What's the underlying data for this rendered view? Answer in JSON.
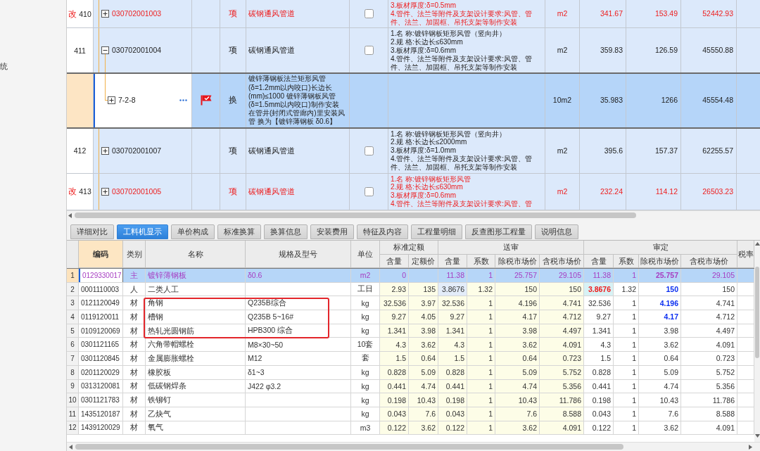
{
  "side_panel": {
    "label": "统"
  },
  "items_table": {
    "rows": [
      {
        "mark": "改",
        "no": "410",
        "modified": true,
        "expanded": false,
        "selected": false,
        "flagged": false,
        "code": "030702001003",
        "type": "项",
        "name": "碳钢通风管道",
        "checked": false,
        "description": [
          "3.板材厚度:δ=0.5mm",
          "4.管件、法兰等附件及支架设计要求:风管、管件、法兰、加固框、吊托支架等制作安装"
        ],
        "unit": "m2",
        "quantity": "341.67",
        "unit_price": "153.49",
        "total": "52442.93"
      },
      {
        "no": "411",
        "modified": false,
        "expanded": true,
        "selected": false,
        "flagged": false,
        "code": "030702001004",
        "type": "项",
        "name": "碳钢通风管道",
        "checked": false,
        "description": [
          "1.名 称:镀锌钢板矩形风管（竖向井）",
          "2.规 格:长边长≤630mm",
          "3.板材厚度:δ=0.6mm",
          "4.管件、法兰等附件及支架设计要求:风管、管件、法兰、加固框、吊托支架等制作安装"
        ],
        "unit": "m2",
        "quantity": "359.83",
        "unit_price": "126.59",
        "total": "45550.88",
        "children": [
          {
            "modified": false,
            "expanded": false,
            "selected": true,
            "flagged": true,
            "code": "7-2-8",
            "type": "换",
            "name": "镀锌薄钢板法兰矩形风管(δ=1.2mm以内咬口)长边长(mm)≤1000 镀锌薄钢板风管(δ=1.5mm以内咬口)制作安装在管井(封闭式管廊内)里安装风管 换为【镀锌薄钢板 δ0.6】",
            "unit": "10m2",
            "quantity": "35.983",
            "unit_price": "1266",
            "total": "45554.48"
          }
        ]
      },
      {
        "no": "412",
        "modified": false,
        "expanded": false,
        "selected": false,
        "flagged": false,
        "code": "030702001007",
        "type": "项",
        "name": "碳钢通风管道",
        "checked": false,
        "description": [
          "1.名 称:镀锌钢板矩形风管（竖向井）",
          "2.规 格:长边长≤2000mm",
          "3.板材厚度:δ=1.0mm",
          "4.管件、法兰等附件及支架设计要求:风管、管件、法兰、加固框、吊托支架等制作安装"
        ],
        "unit": "m2",
        "quantity": "395.6",
        "unit_price": "157.37",
        "total": "62255.57"
      },
      {
        "mark": "改",
        "no": "413",
        "modified": true,
        "expanded": false,
        "selected": false,
        "flagged": false,
        "code": "030702001005",
        "type": "项",
        "name": "碳钢通风管道",
        "checked": false,
        "description": [
          "1.名 称:镀锌钢板矩形风管",
          "2.规 格:长边长≤630mm",
          "3.板材厚度:δ=0.6mm",
          "4.管件、法兰等附件及支架设计要求:风管、管"
        ],
        "unit": "m2",
        "quantity": "232.24",
        "unit_price": "114.12",
        "total": "26503.23"
      }
    ]
  },
  "tabs": [
    {
      "label": "详细对比",
      "selected": false
    },
    {
      "label": "工料机显示",
      "selected": true
    },
    {
      "label": "单价构成",
      "selected": false
    },
    {
      "label": "标准换算",
      "selected": false
    },
    {
      "label": "换算信息",
      "selected": false
    },
    {
      "label": "安装费用",
      "selected": false
    },
    {
      "label": "特征及内容",
      "selected": false
    },
    {
      "label": "工程量明细",
      "selected": false
    },
    {
      "label": "反查图形工程量",
      "selected": false
    },
    {
      "label": "说明信息",
      "selected": false
    }
  ],
  "resources_table": {
    "header": [
      {
        "label": "编码",
        "selected": true
      },
      {
        "label": "类别",
        "selected": false
      },
      {
        "label": "名称",
        "selected": false
      },
      {
        "label": "规格及型号",
        "selected": false
      },
      {
        "label": "单位",
        "selected": false
      },
      {
        "label": "标准定额",
        "selected": false,
        "children": [
          {
            "label": "含量"
          },
          {
            "label": "定额价"
          }
        ]
      },
      {
        "label": "送审",
        "selected": false,
        "children": [
          {
            "label": "含量"
          },
          {
            "label": "系数"
          },
          {
            "label": "除税市场价"
          },
          {
            "label": "含税市场价"
          }
        ]
      },
      {
        "label": "审定",
        "selected": false,
        "children": [
          {
            "label": "含量"
          },
          {
            "label": "系数"
          },
          {
            "label": "除税市场价"
          },
          {
            "label": "含税市场价"
          }
        ]
      },
      {
        "label": "税率",
        "selected": false
      }
    ],
    "rows": [
      {
        "no": "1",
        "selected": true,
        "boxed": false,
        "qty_adjusted": false,
        "price_adjusted": true,
        "code": "0129330017",
        "category": "主",
        "name": "镀锌薄钢板",
        "spec": "δ0.6",
        "unit": "m2",
        "std_qty": "0",
        "sub_qty": "11.38",
        "sub_coef": "1",
        "sub_price_ex": "25.757",
        "sub_price_in": "29.105",
        "aud_qty": "11.38",
        "aud_coef": "1",
        "aud_price_ex": "25.757",
        "aud_price_in": "29.105"
      },
      {
        "no": "2",
        "selected": false,
        "boxed": false,
        "qty_adjusted": true,
        "price_adjusted": true,
        "code": "0001110003",
        "category": "人",
        "name": "二类人工",
        "unit": "工日",
        "std_qty": "2.93",
        "std_price": "135",
        "sub_qty": "3.8676",
        "sub_coef": "1.32",
        "sub_price_ex": "150",
        "sub_price_in": "150",
        "aud_qty": "3.8676",
        "aud_coef": "1.32",
        "aud_price_ex": "150",
        "aud_price_in": "150"
      },
      {
        "no": "3",
        "selected": false,
        "boxed": true,
        "qty_adjusted": false,
        "price_adjusted": true,
        "code": "0121120049",
        "category": "材",
        "name": "角钢",
        "spec": "Q235B综合",
        "unit": "kg",
        "std_qty": "32.536",
        "std_price": "3.97",
        "sub_qty": "32.536",
        "sub_coef": "1",
        "sub_price_ex": "4.196",
        "sub_price_in": "4.741",
        "aud_qty": "32.536",
        "aud_coef": "1",
        "aud_price_ex": "4.196",
        "aud_price_in": "4.741"
      },
      {
        "no": "4",
        "selected": false,
        "boxed": true,
        "qty_adjusted": false,
        "price_adjusted": true,
        "code": "0119120011",
        "category": "材",
        "name": "槽钢",
        "spec": "Q235B 5~16#",
        "unit": "kg",
        "std_qty": "9.27",
        "std_price": "4.05",
        "sub_qty": "9.27",
        "sub_coef": "1",
        "sub_price_ex": "4.17",
        "sub_price_in": "4.712",
        "aud_qty": "9.27",
        "aud_coef": "1",
        "aud_price_ex": "4.17",
        "aud_price_in": "4.712"
      },
      {
        "no": "5",
        "selected": false,
        "boxed": true,
        "qty_adjusted": false,
        "price_adjusted": false,
        "code": "0109120069",
        "category": "材",
        "name": "热轧光圆钢筋",
        "spec": "HPB300 综合",
        "unit": "kg",
        "std_qty": "1.341",
        "std_price": "3.98",
        "sub_qty": "1.341",
        "sub_coef": "1",
        "sub_price_ex": "3.98",
        "sub_price_in": "4.497",
        "aud_qty": "1.341",
        "aud_coef": "1",
        "aud_price_ex": "3.98",
        "aud_price_in": "4.497"
      },
      {
        "no": "6",
        "selected": false,
        "boxed": false,
        "qty_adjusted": false,
        "price_adjusted": false,
        "code": "0301121165",
        "category": "材",
        "name": "六角带帽螺栓",
        "spec": "M8×30~50",
        "unit": "10套",
        "std_qty": "4.3",
        "std_price": "3.62",
        "sub_qty": "4.3",
        "sub_coef": "1",
        "sub_price_ex": "3.62",
        "sub_price_in": "4.091",
        "aud_qty": "4.3",
        "aud_coef": "1",
        "aud_price_ex": "3.62",
        "aud_price_in": "4.091"
      },
      {
        "no": "7",
        "selected": false,
        "boxed": false,
        "qty_adjusted": false,
        "price_adjusted": false,
        "code": "0301120845",
        "category": "材",
        "name": "金属膨胀螺栓",
        "spec": "M12",
        "unit": "套",
        "std_qty": "1.5",
        "std_price": "0.64",
        "sub_qty": "1.5",
        "sub_coef": "1",
        "sub_price_ex": "0.64",
        "sub_price_in": "0.723",
        "aud_qty": "1.5",
        "aud_coef": "1",
        "aud_price_ex": "0.64",
        "aud_price_in": "0.723"
      },
      {
        "no": "8",
        "selected": false,
        "boxed": false,
        "qty_adjusted": false,
        "price_adjusted": false,
        "code": "0201120029",
        "category": "材",
        "name": "橡胶板",
        "spec": "δ1~3",
        "unit": "kg",
        "std_qty": "0.828",
        "std_price": "5.09",
        "sub_qty": "0.828",
        "sub_coef": "1",
        "sub_price_ex": "5.09",
        "sub_price_in": "5.752",
        "aud_qty": "0.828",
        "aud_coef": "1",
        "aud_price_ex": "5.09",
        "aud_price_in": "5.752"
      },
      {
        "no": "9",
        "selected": false,
        "boxed": false,
        "qty_adjusted": false,
        "price_adjusted": false,
        "code": "0313120081",
        "category": "材",
        "name": "低碳钢焊条",
        "spec": "J422 φ3.2",
        "unit": "kg",
        "std_qty": "0.441",
        "std_price": "4.74",
        "sub_qty": "0.441",
        "sub_coef": "1",
        "sub_price_ex": "4.74",
        "sub_price_in": "5.356",
        "aud_qty": "0.441",
        "aud_coef": "1",
        "aud_price_ex": "4.74",
        "aud_price_in": "5.356"
      },
      {
        "no": "10",
        "selected": false,
        "boxed": false,
        "qty_adjusted": false,
        "price_adjusted": false,
        "code": "0301121783",
        "category": "材",
        "name": "铁铆钉",
        "unit": "kg",
        "std_qty": "0.198",
        "std_price": "10.43",
        "sub_qty": "0.198",
        "sub_coef": "1",
        "sub_price_ex": "10.43",
        "sub_price_in": "11.786",
        "aud_qty": "0.198",
        "aud_coef": "1",
        "aud_price_ex": "10.43",
        "aud_price_in": "11.786"
      },
      {
        "no": "11",
        "selected": false,
        "boxed": false,
        "qty_adjusted": false,
        "price_adjusted": false,
        "code": "1435120187",
        "category": "材",
        "name": "乙炔气",
        "unit": "kg",
        "std_qty": "0.043",
        "std_price": "7.6",
        "sub_qty": "0.043",
        "sub_coef": "1",
        "sub_price_ex": "7.6",
        "sub_price_in": "8.588",
        "aud_qty": "0.043",
        "aud_coef": "1",
        "aud_price_ex": "7.6",
        "aud_price_in": "8.588"
      },
      {
        "no": "12",
        "selected": false,
        "boxed": false,
        "qty_adjusted": false,
        "price_adjusted": false,
        "code": "1439120029",
        "category": "材",
        "name": "氧气",
        "unit": "m3",
        "std_qty": "0.122",
        "std_price": "3.62",
        "sub_qty": "0.122",
        "sub_coef": "1",
        "sub_price_ex": "3.62",
        "sub_price_in": "4.091",
        "aud_qty": "0.122",
        "aud_coef": "1",
        "aud_price_ex": "3.62",
        "aud_price_in": "4.091"
      }
    ]
  }
}
